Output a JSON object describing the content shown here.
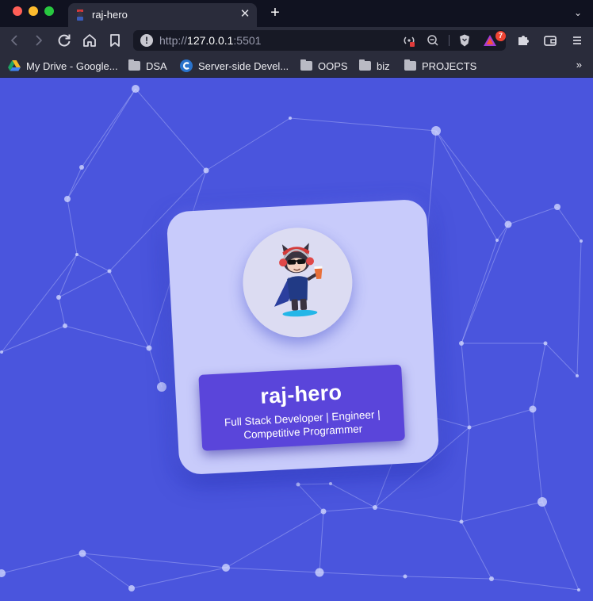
{
  "browser": {
    "tab": {
      "title": "raj-hero",
      "close_glyph": "✕",
      "favicon": "octocat-favicon-icon"
    },
    "new_tab_glyph": "+",
    "tabs_menu_glyph": "⌄",
    "url": {
      "scheme": "http://",
      "host": "127.0.0.1",
      "port": ":5501"
    },
    "rewards_count": "7",
    "bookmarks": [
      {
        "label": "My Drive - Google...",
        "icon": "google-drive-icon"
      },
      {
        "label": "DSA",
        "icon": "folder-icon"
      },
      {
        "label": "Server-side Devel...",
        "icon": "coursera-icon"
      },
      {
        "label": "OOPS",
        "icon": "folder-icon"
      },
      {
        "label": "biz",
        "icon": "folder-icon"
      },
      {
        "label": "PROJECTS",
        "icon": "folder-icon"
      }
    ],
    "bookmarks_more": "»"
  },
  "profile": {
    "name": "raj-hero",
    "role": "Full Stack Developer | Engineer | Competitive Programmer",
    "avatar": "octocat-hero-avatar"
  },
  "colors": {
    "page_background": "#4a55dd",
    "card_background": "#c8cbfb",
    "banner_background": "#5a45da",
    "chrome_dark": "#101220",
    "chrome_toolbar": "#2a2c3b"
  }
}
